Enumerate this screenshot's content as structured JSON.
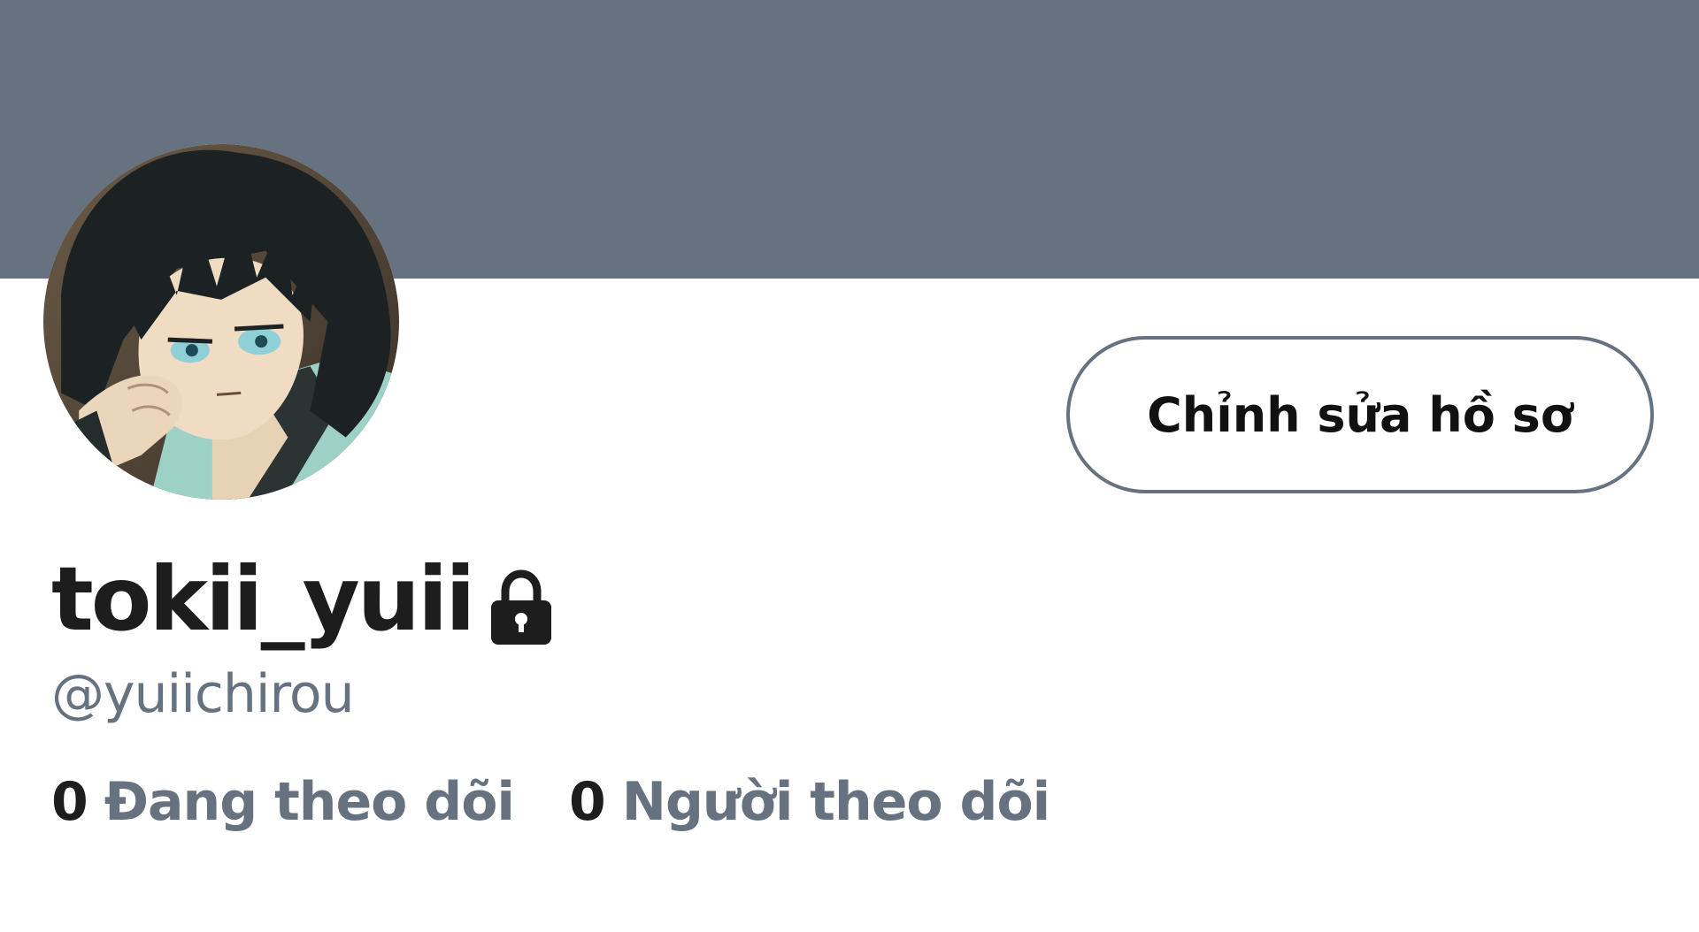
{
  "banner": {
    "color": "#66727f"
  },
  "avatar": {
    "description_icon": "profile-picture"
  },
  "profile": {
    "display_name": "tokii_yuii",
    "handle": "@yuiichirou",
    "locked_icon": "lock-icon"
  },
  "edit_button": {
    "label": "Chỉnh sửa hồ sơ"
  },
  "stats": {
    "following_count": "0",
    "following_label": "Đang theo dõi",
    "followers_count": "0",
    "followers_label": "Người theo dõi"
  },
  "colors": {
    "text_primary": "#1d1d1d",
    "text_secondary": "#66727f",
    "background": "#ffffff"
  }
}
